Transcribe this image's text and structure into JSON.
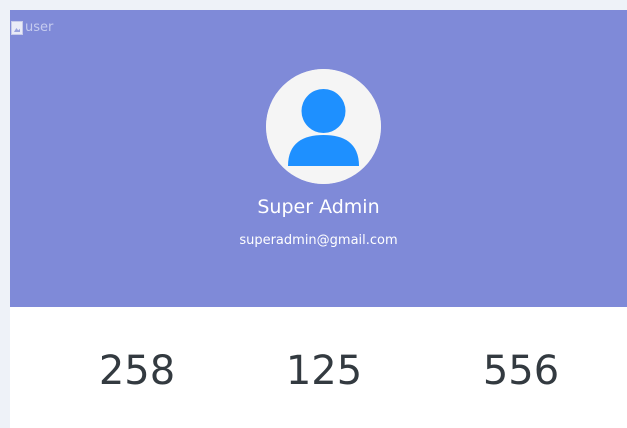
{
  "profile": {
    "broken_image_alt": "user",
    "name": "Super Admin",
    "email": "superadmin@gmail.com",
    "avatar_icon": "user-avatar-icon",
    "header_color": "#7f8ad8",
    "avatar_color": "#1e90ff"
  },
  "stats": {
    "values": [
      "258",
      "125",
      "556"
    ]
  }
}
